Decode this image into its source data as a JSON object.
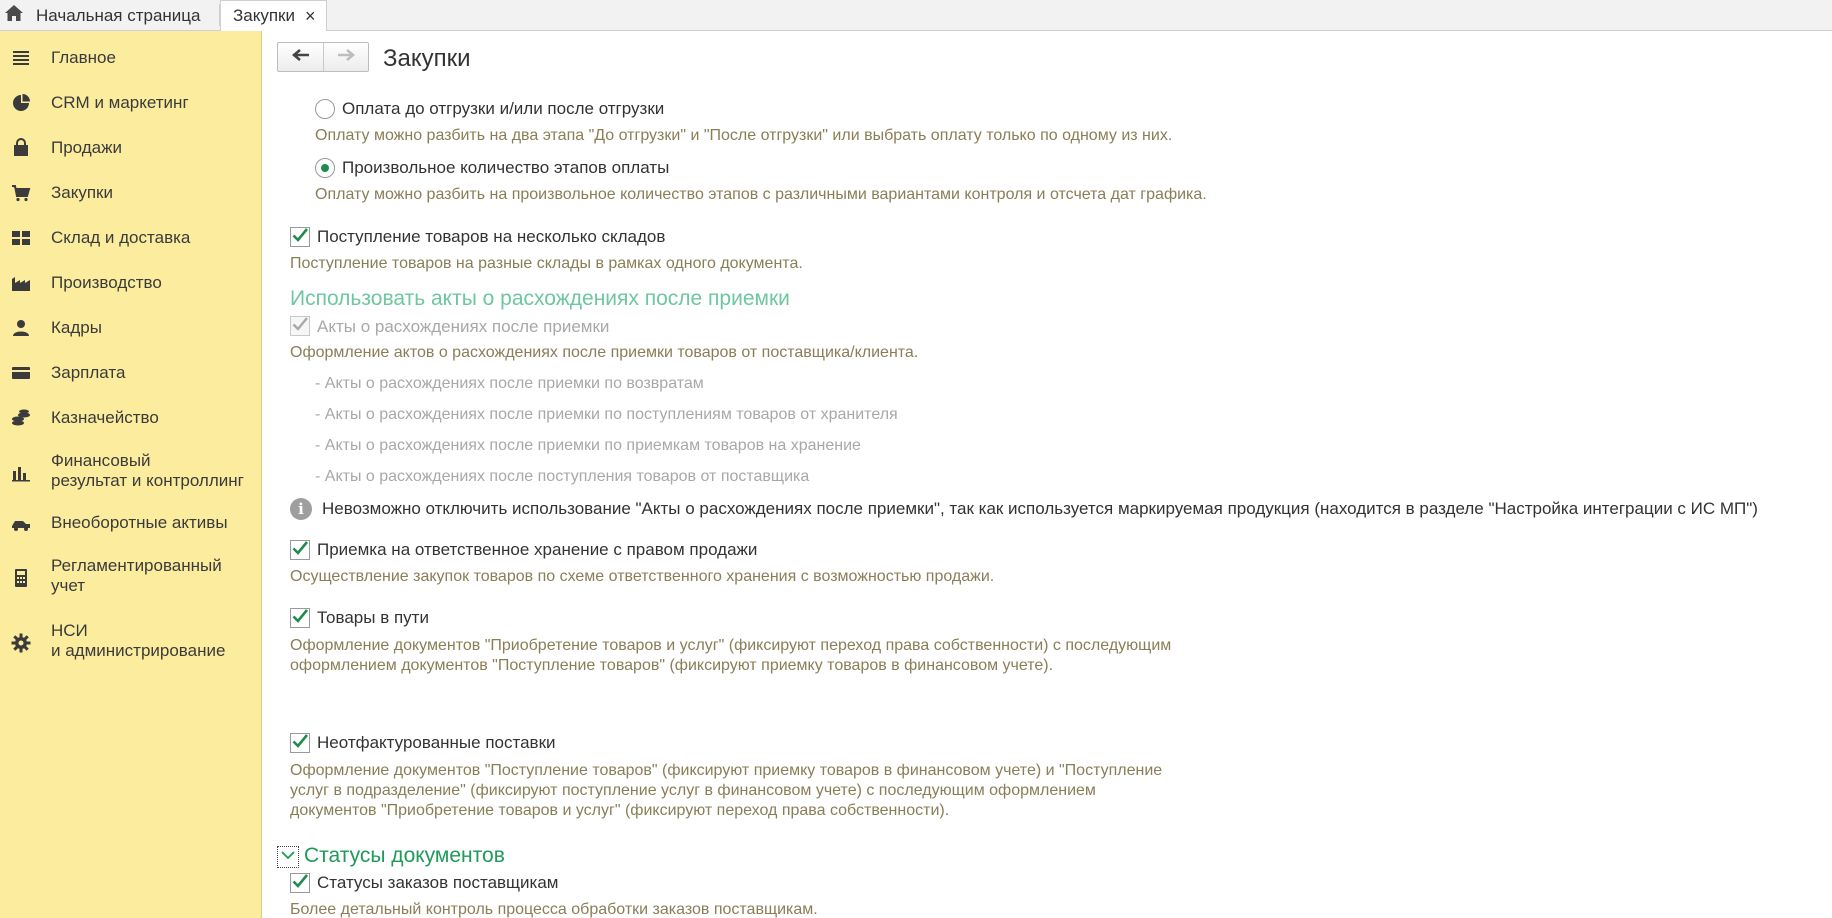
{
  "tabs": {
    "home_label": "Начальная страница",
    "active_label": "Закупки",
    "close_glyph": "×"
  },
  "sidebar": {
    "items": [
      {
        "label": "Главное",
        "icon": "menu-lines-icon"
      },
      {
        "label": "CRM и маркетинг",
        "icon": "pie-chart-icon"
      },
      {
        "label": "Продажи",
        "icon": "shopping-bag-icon"
      },
      {
        "label": "Закупки",
        "icon": "cart-icon"
      },
      {
        "label": "Склад и доставка",
        "icon": "warehouse-grid-icon"
      },
      {
        "label": "Производство",
        "icon": "factory-icon"
      },
      {
        "label": "Кадры",
        "icon": "person-icon"
      },
      {
        "label": "Зарплата",
        "icon": "card-icon"
      },
      {
        "label": "Казначейство",
        "icon": "coins-icon"
      },
      {
        "label_line1": "Финансовый",
        "label_line2": "результат и контроллинг",
        "icon": "bar-chart-icon"
      },
      {
        "label": "Внеоборотные активы",
        "icon": "truck-icon"
      },
      {
        "label_line1": "Регламентированный",
        "label_line2": "учет",
        "icon": "calculator-icon"
      },
      {
        "label_line1": "НСИ",
        "label_line2": "и администрирование",
        "icon": "gear-icon"
      }
    ]
  },
  "main": {
    "title": "Закупки",
    "radio_prepost": {
      "label": "Оплата до отгрузки и/или после отгрузки",
      "desc": "Оплату можно разбить на два этапа \"До отгрузки\" и \"После отгрузки\" или выбрать оплату только по одному из них.",
      "selected": false
    },
    "radio_arbitrary": {
      "label": "Произвольное количество этапов оплаты",
      "desc": "Оплату можно разбить на произвольное количество этапов с различными вариантами контроля и отсчета дат графика.",
      "selected": true
    },
    "cb_multi_warehouse": {
      "label": "Поступление товаров на несколько складов",
      "desc": "Поступление товаров на разные склады в рамках одного документа.",
      "checked": true
    },
    "section_discrepancy": {
      "heading": "Использовать акты о расхождениях после приемки",
      "cb_label": "Акты о расхождениях после приемки",
      "desc": "Оформление актов о расхождениях после приемки товаров от поставщика/клиента.",
      "sub_items": [
        "- Акты о расхождениях после приемки по возвратам",
        "- Акты о расхождениях после приемки по поступлениям товаров от хранителя",
        "- Акты о расхождениях после приемки по приемкам товаров на хранение",
        "- Акты о расхождениях после поступления товаров от поставщика"
      ],
      "info": "Невозможно отключить использование \"Акты о расхождениях после приемки\", так как используется маркируемая продукция (находится в разделе \"Настройка интеграции с ИС МП\")"
    },
    "cb_custody": {
      "label": "Приемка на ответственное хранение с правом продажи",
      "desc": "Осуществление закупок товаров по схеме ответственного хранения с возможностью продажи.",
      "checked": true
    },
    "cb_in_transit": {
      "label": "Товары в пути",
      "desc_line1": "Оформление документов \"Приобретение товаров и услуг\" (фиксируют переход права собственности) с последующим",
      "desc_line2": "оформлением документов \"Поступление товаров\" (фиксируют приемку товаров в финансовом учете).",
      "checked": true
    },
    "cb_uninvoiced": {
      "label": "Неотфактурованные поставки",
      "desc_line1": "Оформление документов \"Поступление товаров\" (фиксируют приемку товаров в финансовом учете) и \"Поступление",
      "desc_line2": "услуг в подразделение\" (фиксируют поступление услуг в финансовом учете) с последующим оформлением",
      "desc_line3": "документов  \"Приобретение товаров и услуг\" (фиксируют переход права собственности).",
      "checked": true
    },
    "section_statuses": {
      "heading": "Статусы документов",
      "cb_label": "Статусы заказов поставщикам",
      "desc": "Более детальный контроль процесса обработки заказов поставщикам.",
      "checked": true
    }
  },
  "colors": {
    "sidebar_bg": "#fbec9e",
    "accent_green": "#1f9a5a",
    "muted_green": "#6ec7a0",
    "desc_text": "#8a7e57"
  }
}
